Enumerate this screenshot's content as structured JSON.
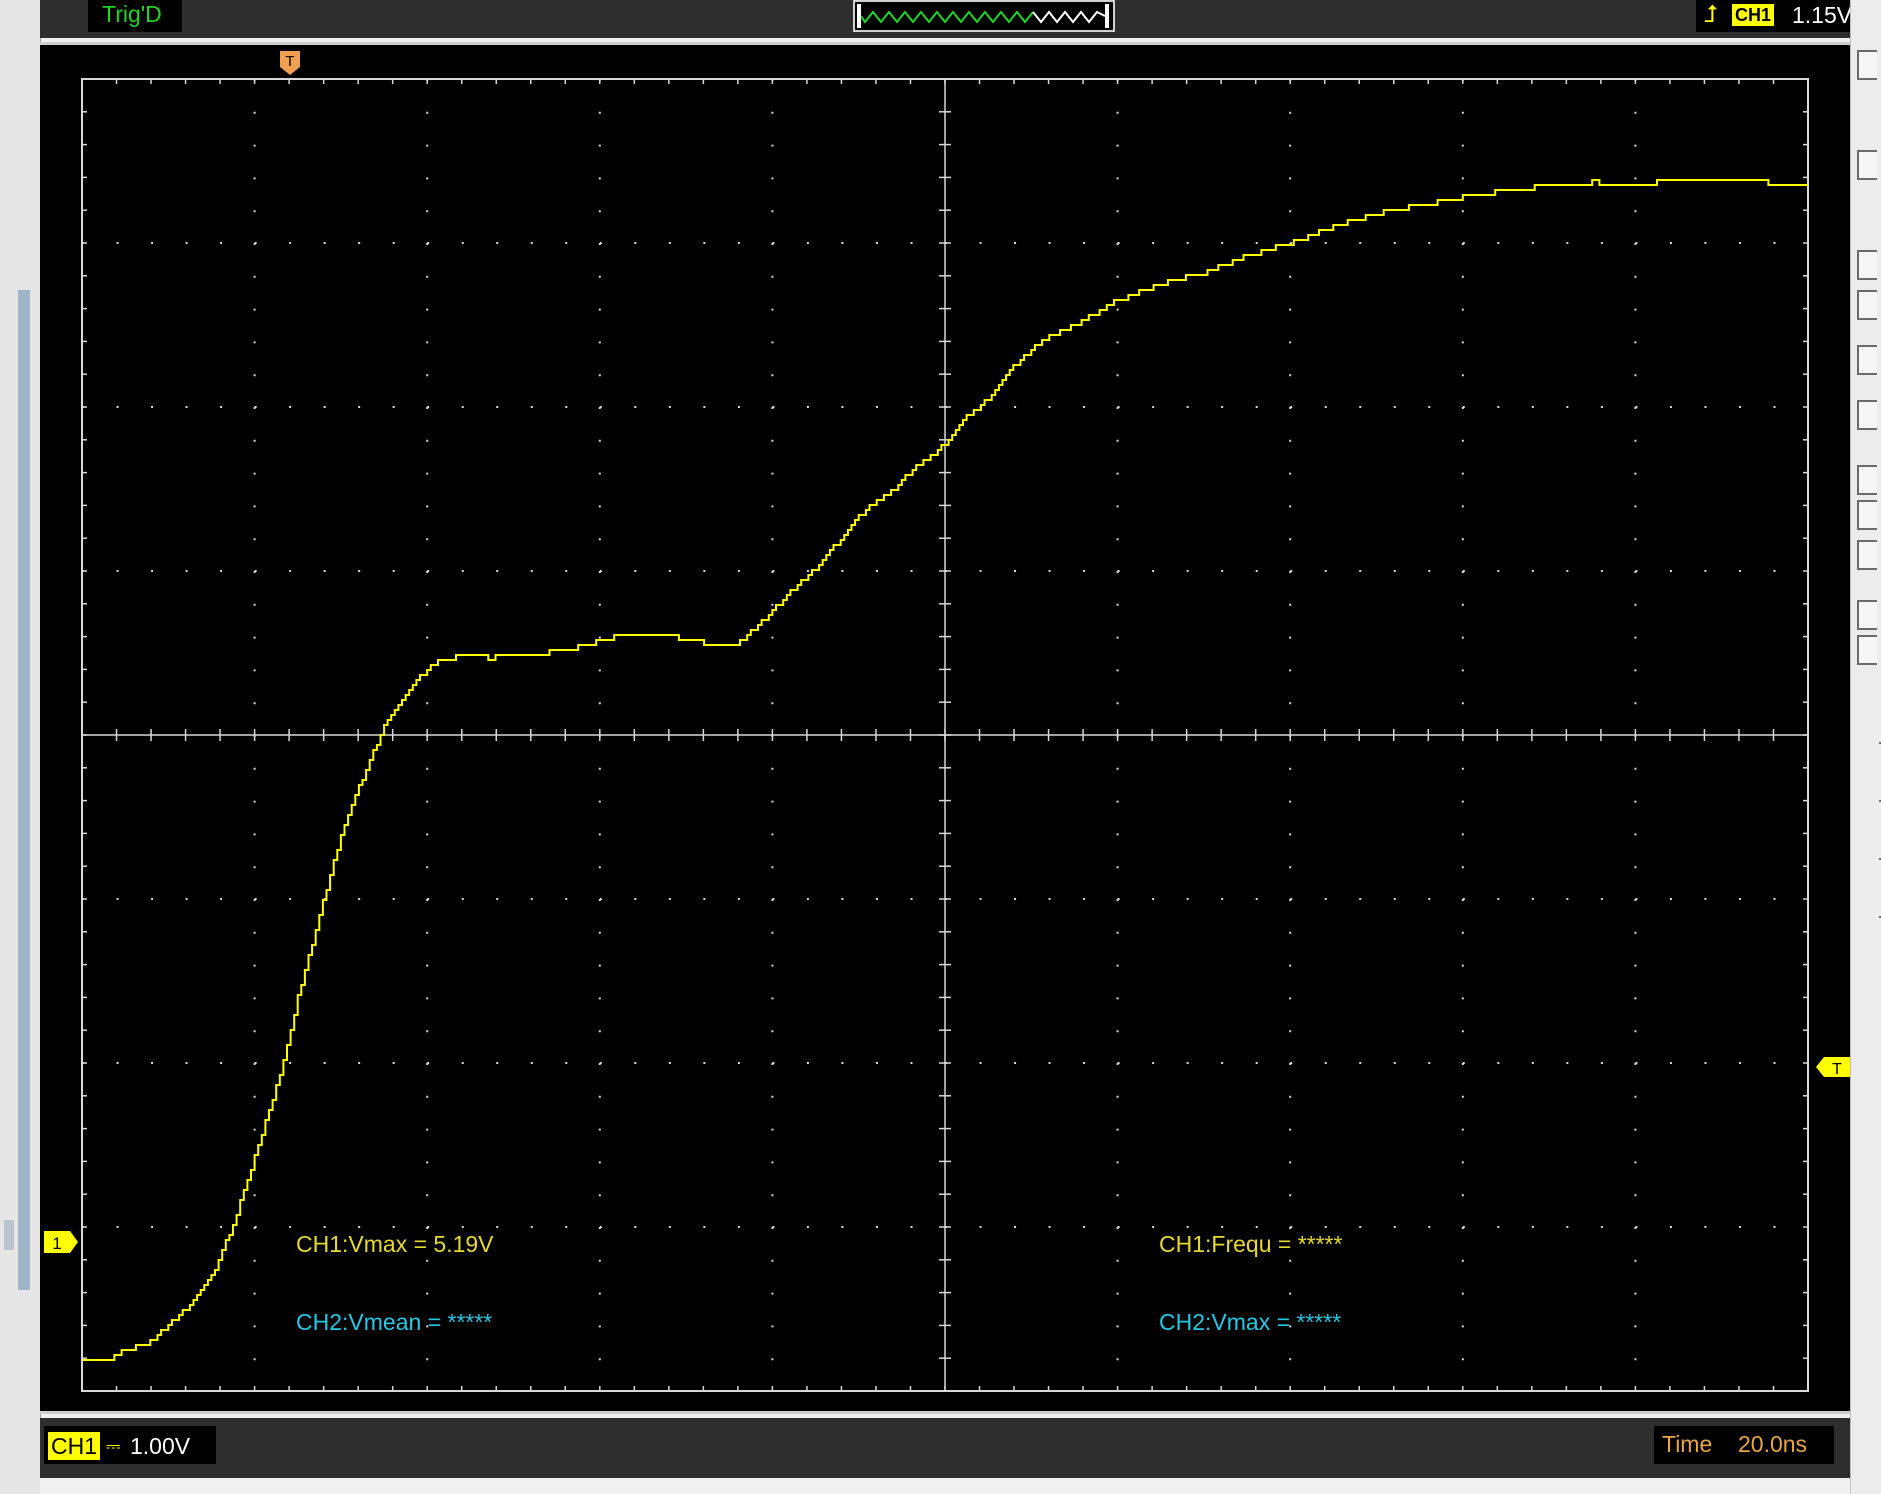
{
  "top_bar": {
    "trigger_status": "Trig'D",
    "trigger_channel": "CH1",
    "trigger_level": "1.15V",
    "trigger_edge_icon": "rising-edge-icon"
  },
  "markers": {
    "trigger_position": "T",
    "trigger_level": "T",
    "channel1_ground": "1"
  },
  "measurements": {
    "ch1_vmax": "CH1:Vmax = 5.19V",
    "ch1_frequ": "CH1:Frequ = *****",
    "ch2_vmean": "CH2:Vmean = *****",
    "ch2_vmax": "CH2:Vmax = *****"
  },
  "bottom_bar": {
    "channel_label": "CH1",
    "coupling": "⎓",
    "volts_per_div": "1.00V",
    "time_label": "Time",
    "time_per_div": "20.0ns"
  },
  "colors": {
    "ch1": "#ffff00",
    "ch2": "#25c8e6",
    "grid": "#d8d8d8",
    "status_green": "#22d422",
    "time_orange": "#e8a642",
    "trigger_marker": "#f0a050"
  },
  "chart_data": {
    "type": "line",
    "title": "",
    "xlabel": "",
    "ylabel": "",
    "x_unit": "ns",
    "y_unit": "V",
    "xlim": [
      -15,
      185
    ],
    "ylim": [
      -0.2,
      7.8
    ],
    "grid": true,
    "series": [
      {
        "name": "CH1",
        "color": "#ffff00",
        "points": [
          [
            -15,
            0.0
          ],
          [
            -12,
            -0.02
          ],
          [
            -10,
            0.05
          ],
          [
            -7,
            0.1
          ],
          [
            -4,
            0.25
          ],
          [
            -2,
            0.35
          ],
          [
            0,
            0.5
          ],
          [
            2,
            0.75
          ],
          [
            4,
            1.05
          ],
          [
            6,
            1.4
          ],
          [
            8,
            1.75
          ],
          [
            10,
            2.2
          ],
          [
            12,
            2.6
          ],
          [
            14,
            3.0
          ],
          [
            16,
            3.35
          ],
          [
            18,
            3.6
          ],
          [
            20,
            3.85
          ],
          [
            22,
            4.0
          ],
          [
            24,
            4.15
          ],
          [
            26,
            4.25
          ],
          [
            28,
            4.27
          ],
          [
            30,
            4.3
          ],
          [
            32,
            4.27
          ],
          [
            35,
            4.28
          ],
          [
            38,
            4.3
          ],
          [
            41,
            4.31
          ],
          [
            44,
            4.36
          ],
          [
            47,
            4.4
          ],
          [
            50,
            4.42
          ],
          [
            53,
            4.4
          ],
          [
            56,
            4.38
          ],
          [
            58,
            4.35
          ],
          [
            61,
            4.36
          ],
          [
            64,
            4.5
          ],
          [
            67,
            4.67
          ],
          [
            70,
            4.82
          ],
          [
            73,
            5.0
          ],
          [
            76,
            5.19
          ],
          [
            79,
            5.3
          ],
          [
            82,
            5.45
          ],
          [
            85,
            5.57
          ],
          [
            87,
            5.72
          ],
          [
            90,
            5.85
          ],
          [
            93,
            6.05
          ],
          [
            96,
            6.2
          ],
          [
            100,
            6.3
          ],
          [
            105,
            6.45
          ],
          [
            110,
            6.55
          ],
          [
            115,
            6.62
          ],
          [
            120,
            6.72
          ],
          [
            125,
            6.8
          ],
          [
            130,
            6.9
          ],
          [
            135,
            6.98
          ],
          [
            140,
            7.03
          ],
          [
            145,
            7.08
          ],
          [
            150,
            7.12
          ],
          [
            155,
            7.15
          ],
          [
            160,
            7.17
          ],
          [
            165,
            7.16
          ],
          [
            170,
            7.18
          ],
          [
            175,
            7.18
          ],
          [
            180,
            7.17
          ],
          [
            185,
            7.15
          ]
        ]
      }
    ]
  }
}
